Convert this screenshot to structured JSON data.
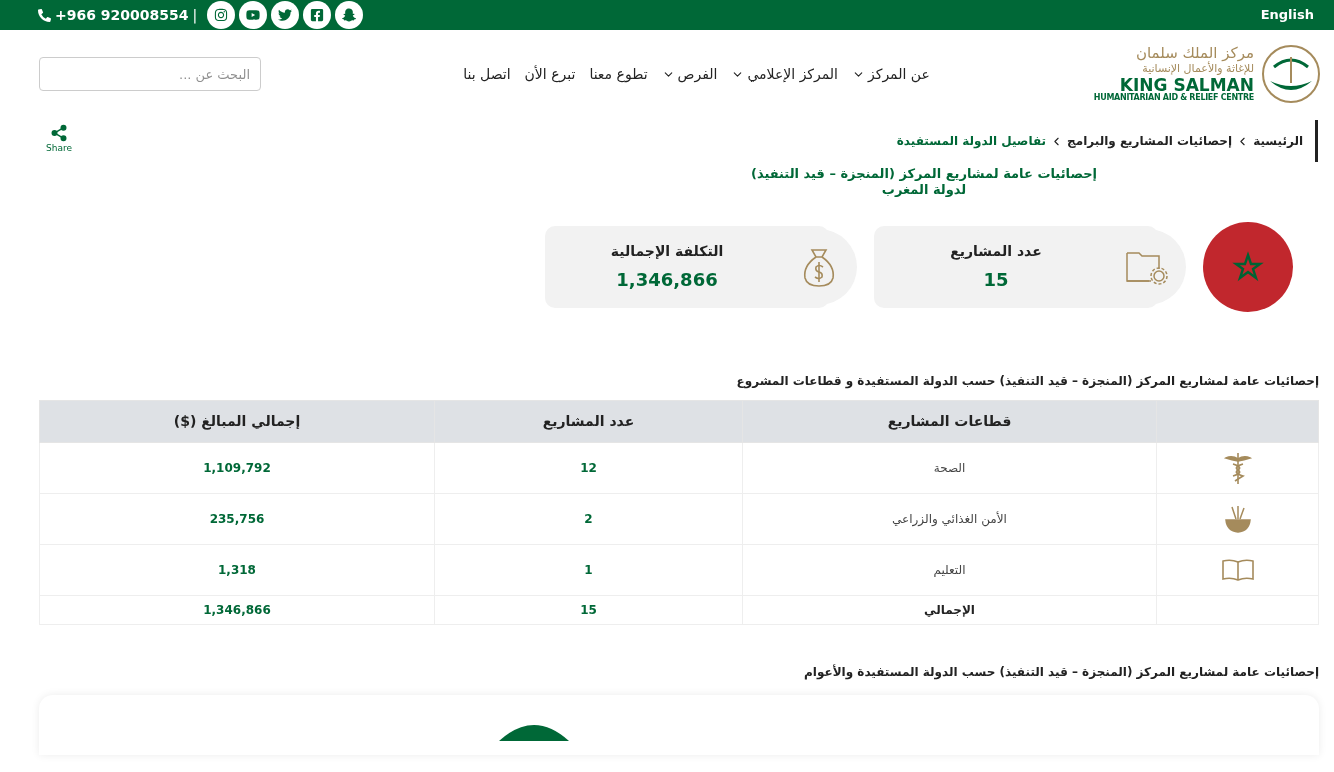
{
  "top_bar": {
    "language": "English",
    "phone": "+966 920008554",
    "separator": "|"
  },
  "logo": {
    "arabic_line_1": "مركز الملك سلمان",
    "arabic_line_2": "للإغاثة والأعمال الإنسانية",
    "english_name": "KING SALMAN",
    "english_subtitle": "HUMANITARIAN AID & RELIEF CENTRE"
  },
  "nav": [
    {
      "label": "عن المركز",
      "dropdown": true
    },
    {
      "label": "المركز الإعلامي",
      "dropdown": true
    },
    {
      "label": "الفرص",
      "dropdown": true
    },
    {
      "label": "تطوع معنا",
      "dropdown": false
    },
    {
      "label": "تبرع الأن",
      "dropdown": false
    },
    {
      "label": "اتصل بنا",
      "dropdown": false
    }
  ],
  "search": {
    "placeholder": "البحث عن ..."
  },
  "breadcrumb": [
    {
      "label": "الرئيسية",
      "current": false
    },
    {
      "label": "إحصائيات المشاريع والبرامج",
      "current": false
    },
    {
      "label": "تفاصيل الدولة المستفيدة",
      "current": true
    }
  ],
  "share": {
    "label": "Share"
  },
  "heading": {
    "line_1": "إحصائيات عامة لمشاريع المركز (المنجزة – قيد التنفيذ)",
    "line_2": "لدولة المغرب"
  },
  "stats": [
    {
      "kind": "projects",
      "label": "عدد المشاريع",
      "value": "15"
    },
    {
      "kind": "cost",
      "label": "التكلفة الإجمالية",
      "value": "1,346,866"
    }
  ],
  "sectors_table": {
    "title": "إحصائيات عامة لمشاريع المركز (المنجزة – قيد التنفيذ) حسب الدولة المستفيدة و قطاعات المشروع",
    "columns": [
      "قطاعات المشاريع",
      "عدد المشاريع",
      "إجمالي المبالغ ($)"
    ],
    "rows": [
      {
        "kind": "health",
        "sector": "الصحة",
        "count": "12",
        "total": "1,109,792"
      },
      {
        "kind": "food",
        "sector": "الأمن الغذائي والزراعي",
        "count": "2",
        "total": "235,756"
      },
      {
        "kind": "education",
        "sector": "التعليم",
        "count": "1",
        "total": "1,318"
      },
      {
        "kind": "summary",
        "sector": "الإجمالي",
        "count": "15",
        "total": "1,346,866"
      }
    ]
  },
  "years_section": {
    "title": "إحصائيات عامة لمشاريع المركز (المنجزة – قيد التنفيذ) حسب الدولة المستفيدة والأعوام"
  }
}
